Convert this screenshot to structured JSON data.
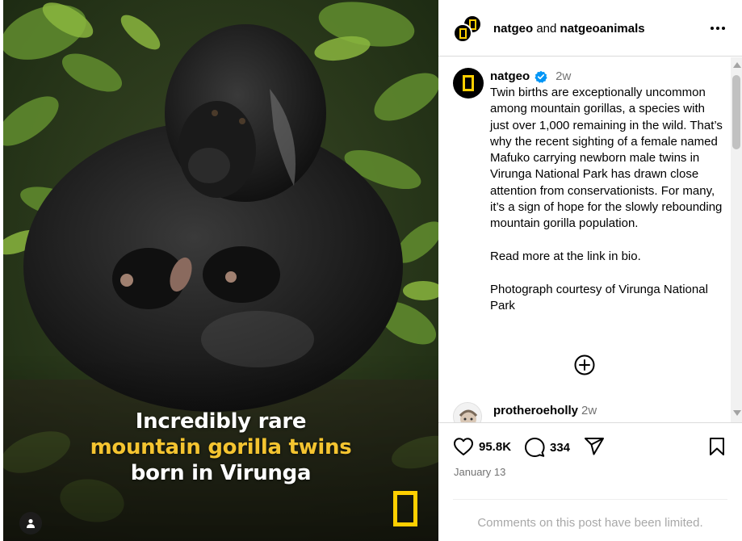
{
  "media": {
    "caption_line1": "Incredibly rare",
    "caption_line2": "mountain gorilla twins",
    "caption_line3": "born in Virunga",
    "caption_highlight_color": "#f4c430",
    "brand_mark": "natgeo-yellow-frame",
    "brand_color": "#ffcf00"
  },
  "header": {
    "account1": "natgeo",
    "joiner": " and ",
    "account2": "natgeoanimals",
    "more_icon": "more-horizontal-icon"
  },
  "post": {
    "username": "natgeo",
    "verified_icon": "verified-badge-icon",
    "verified_color": "#0095f6",
    "age": "2w",
    "caption": "Twin births are exceptionally uncommon among mountain gorillas, a species with just over 1,000 remaining in the wild. That’s why the recent sighting of a female named Mafuko carrying newborn male twins in Virunga National Park has drawn close attention from conservationists. For many, it’s a sign of hope for the slowly rebounding mountain gorilla population.\n\nRead more at the link in bio.\n\nPhotograph courtesy of Virunga National Park",
    "load_more_icon": "plus-circle-icon"
  },
  "comment": {
    "username": "protheroeholly",
    "age": "2w"
  },
  "actions": {
    "likes": "95.8K",
    "comments": "334",
    "date": "January 13",
    "like_icon": "heart-icon",
    "comment_icon": "comment-icon",
    "share_icon": "share-icon",
    "save_icon": "bookmark-icon"
  },
  "footer": {
    "limited_text": "Comments on this post have been limited."
  }
}
